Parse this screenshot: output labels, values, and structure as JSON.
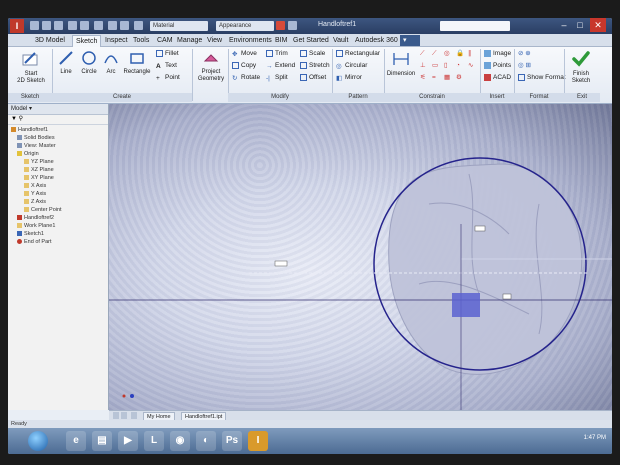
{
  "titlebar": {
    "logo": "I",
    "material": "Material",
    "appearance": "Appearance",
    "document_title": "Handloftref1",
    "search_placeholder": ""
  },
  "tabs": [
    "3D Model",
    "Sketch",
    "Inspect",
    "Tools",
    "CAM",
    "Manage",
    "View",
    "Environments",
    "BIM",
    "Get Started",
    "Vault",
    "Autodesk 360"
  ],
  "active_tab": "Sketch",
  "ribbon": {
    "sketch_panel": {
      "label": "Sketch",
      "start_2d_sketch": "Start\n2D Sketch"
    },
    "create_panel": {
      "label": "Create",
      "line": "Line",
      "circle": "Circle",
      "arc": "Arc",
      "rectangle": "Rectangle",
      "fillet": "Fillet",
      "text": "Text",
      "point": "Point"
    },
    "project_geometry": "Project\nGeometry",
    "modify_panel": {
      "label": "Modify",
      "move": "Move",
      "copy": "Copy",
      "rotate": "Rotate",
      "trim": "Trim",
      "extend": "Extend",
      "split": "Split",
      "scale": "Scale",
      "stretch": "Stretch",
      "offset": "Offset"
    },
    "pattern_panel": {
      "label": "Pattern",
      "rectangular": "Rectangular",
      "circular": "Circular",
      "mirror": "Mirror"
    },
    "dimension": "Dimension",
    "constrain_panel": {
      "label": "Constrain"
    },
    "insert_panel": {
      "label": "Insert",
      "image": "Image",
      "points": "Points",
      "acad": "ACAD"
    },
    "format_panel": {
      "label": "Format",
      "show_format": "Show Format"
    },
    "exit_panel": {
      "label": "Exit",
      "finish_sketch": "Finish\nSketch"
    }
  },
  "browser": {
    "header": "Model",
    "items": [
      "Handloftref1",
      "Solid Bodies",
      "View: Master",
      "Origin",
      "YZ Plane",
      "XZ Plane",
      "XY Plane",
      "X Axis",
      "Y Axis",
      "Z Axis",
      "Center Point",
      "Handloftref2",
      "Work Plane1",
      "Sketch1",
      "End of Part"
    ]
  },
  "doc_tabs": [
    "My Home",
    "Handloftref1.ipt"
  ],
  "status": "Ready",
  "taskbar": {
    "apps": [
      "IE",
      "Folder",
      "Media",
      "L",
      "Chrome",
      "Firefox",
      "PS",
      "I"
    ],
    "clock": "1:47 PM"
  },
  "colors": {
    "sketch_blue": "#25238c",
    "selection_blue": "#5a63d0",
    "accent": "#2a3e63"
  }
}
